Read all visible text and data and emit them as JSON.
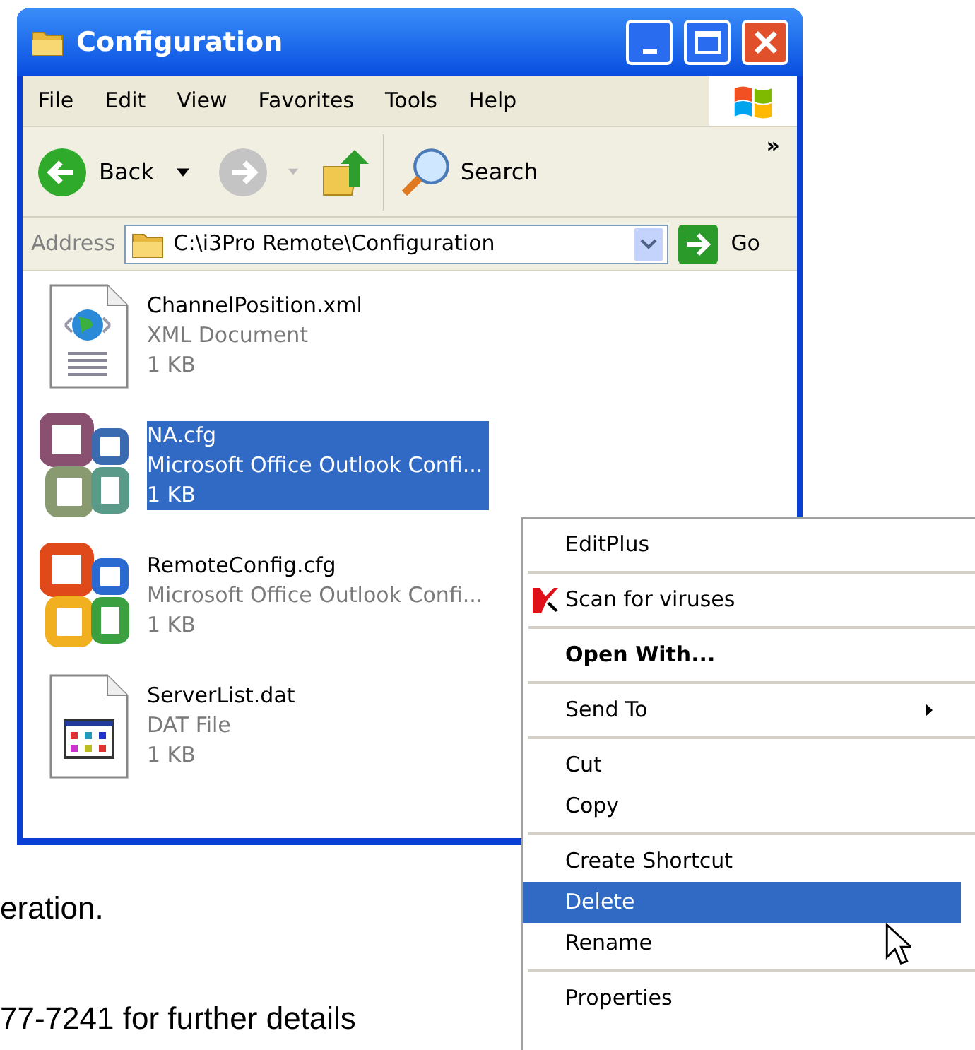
{
  "window": {
    "title": "Configuration"
  },
  "menu": [
    "File",
    "Edit",
    "View",
    "Favorites",
    "Tools",
    "Help"
  ],
  "toolbar": {
    "back": "Back",
    "search": "Search",
    "more": "»"
  },
  "address": {
    "label": "Address",
    "value": "C:\\i3Pro Remote\\Configuration",
    "go": "Go"
  },
  "files": [
    {
      "name": "ChannelPosition.xml",
      "type": "XML Document",
      "size": "1 KB",
      "kind": "xml",
      "selected": false
    },
    {
      "name": "NA.cfg",
      "type": "Microsoft Office Outlook Confi...",
      "size": "1 KB",
      "kind": "office-muted",
      "selected": true
    },
    {
      "name": "RemoteConfig.cfg",
      "type": "Microsoft Office Outlook Confi...",
      "size": "1 KB",
      "kind": "office",
      "selected": false
    },
    {
      "name": "ServerList.dat",
      "type": "DAT File",
      "size": "1 KB",
      "kind": "dat",
      "selected": false
    }
  ],
  "context_menu": [
    [
      {
        "label": "EditPlus",
        "kind": "plain",
        "selected": false
      }
    ],
    [
      {
        "label": "Scan for viruses",
        "kind": "scan",
        "selected": false
      }
    ],
    [
      {
        "label": "Open With...",
        "kind": "default",
        "selected": false
      }
    ],
    [
      {
        "label": "Send To",
        "kind": "submenu",
        "selected": false
      }
    ],
    [
      {
        "label": "Cut",
        "kind": "plain",
        "selected": false
      },
      {
        "label": "Copy",
        "kind": "plain",
        "selected": false
      }
    ],
    [
      {
        "label": "Create Shortcut",
        "kind": "plain",
        "selected": false
      },
      {
        "label": "Delete",
        "kind": "plain",
        "selected": true
      },
      {
        "label": "Rename",
        "kind": "plain",
        "selected": false
      }
    ],
    [
      {
        "label": "Properties",
        "kind": "plain",
        "selected": false
      }
    ]
  ],
  "document": [
    "eration.",
    "77-7241 for further details"
  ]
}
